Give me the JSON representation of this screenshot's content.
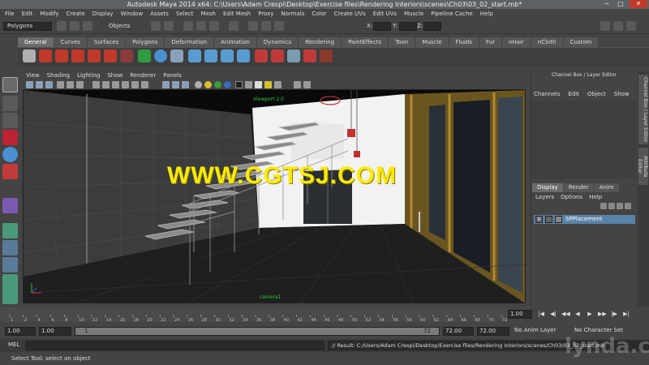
{
  "window": {
    "title": "Autodesk Maya 2014 x64: C:\\Users\\Adam Crespi\\Desktop\\Exercise files\\Rendering Interiors\\scenes\\Ch03\\03_02_start.mb*",
    "minimize": "─",
    "maximize": "□",
    "close": "✕"
  },
  "menubar": [
    "File",
    "Edit",
    "Modify",
    "Create",
    "Display",
    "Window",
    "Assets",
    "Select",
    "Mesh",
    "Edit Mesh",
    "Proxy",
    "Normals",
    "Color",
    "Create UVs",
    "Edit UVs",
    "Muscle",
    "Pipeline Cache",
    "Help"
  ],
  "statusline": {
    "mode": "Polygons",
    "objects_label": "Objects",
    "x_label": "X:",
    "y_label": "Y:",
    "z_label": "Z:"
  },
  "shelf": {
    "tabs": [
      "General",
      "Curves",
      "Surfaces",
      "Polygons",
      "Deformation",
      "Animation",
      "Dynamics",
      "Rendering",
      "PaintEffects",
      "Toon",
      "Muscle",
      "Fluids",
      "Fur",
      "nHair",
      "nCloth",
      "Custom"
    ],
    "active_tab": "General"
  },
  "viewport": {
    "menu": [
      "View",
      "Shading",
      "Lighting",
      "Show",
      "Renderer",
      "Panels"
    ],
    "overlay_label": "Viewport 2.0",
    "camera_label": "camera1",
    "watermark": "WWW.CGTSJ.COM"
  },
  "channel_box": {
    "title": "Channel Box / Layer Editor",
    "menu": [
      "Channels",
      "Edit",
      "Object",
      "Show"
    ],
    "layer_tabs": [
      "Display",
      "Render",
      "Anim"
    ],
    "active_layer_tab": "Display",
    "layer_menu": [
      "Layers",
      "Options",
      "Help"
    ],
    "layer": {
      "visible": "V",
      "name": "SPPlacement"
    }
  },
  "side_tabs": [
    "Channel Box / Layer Editor",
    "Attribute Editor"
  ],
  "timeline": {
    "ticks": [
      "1",
      "2",
      "4",
      "6",
      "8",
      "10",
      "12",
      "14",
      "16",
      "18",
      "20",
      "22",
      "24",
      "26",
      "28",
      "30",
      "32",
      "34",
      "36",
      "38",
      "40",
      "42",
      "44",
      "46",
      "48",
      "50",
      "52",
      "54",
      "56",
      "58",
      "60",
      "62",
      "64",
      "66",
      "68",
      "70",
      "72"
    ],
    "current_frame": "1.00",
    "buttons": [
      "|◀",
      "◀|",
      "◀◀",
      "◀",
      "▶",
      "▶▶",
      "|▶",
      "▶|"
    ]
  },
  "range": {
    "start_time": "1.00",
    "playback_start": "1.00",
    "slider_start": "1",
    "slider_end": "72",
    "playback_end": "72.00",
    "end_time": "72.00",
    "anim_layer": "No Anim Layer",
    "character_set": "No Character Set"
  },
  "command": {
    "mel_label": "MEL",
    "result": "// Result: C:/Users/Adam Crespi/Desktop/Exercise files/Rendering Interiors/scenes/Ch03/03_02_start.mb"
  },
  "helpline": "Select Tool: select an object",
  "brand_watermark": "lynda.com",
  "colors": {
    "viewport_bg": "#181818",
    "watermark": "#ffea00",
    "selected_layer": "#5a82a8",
    "overlay_label": "#2ec82e"
  }
}
